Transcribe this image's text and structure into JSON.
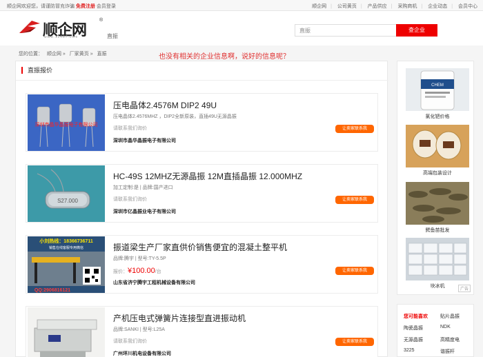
{
  "topbar": {
    "welcome": "顺企网欢迎您，请谨防冒充诈骗",
    "register": "免费注册",
    "login": "会员登录",
    "links": [
      "顺企网",
      "公司黄页",
      "产品供应",
      "采购商机",
      "企业动态",
      "会员中心"
    ]
  },
  "header": {
    "brand": "顺企网",
    "reg_mark": "®",
    "url": "www.11467.com",
    "category": "直振",
    "search_value": "直振",
    "search_button": "查企业"
  },
  "breadcrumb": {
    "prefix": "您的位置：",
    "items": [
      "顺企网",
      "厂家黄页",
      "直振"
    ],
    "sep": "»"
  },
  "overlay_note": "也没有相关的企业信息啊，说好的信息呢？",
  "section_title": "直振报价",
  "products": [
    {
      "title": "压电晶体2.4576M DIP2 49U",
      "desc": "压电晶体2.4576MHZ ，DIP2全新原装，直插49U无源晶振",
      "price_label": "请联系我们询价",
      "price_amount": "",
      "price_unit": "",
      "company": "深圳市晶华晶振电子有限公司",
      "button": "让卖家联系我"
    },
    {
      "title": "HC-49S 12MHZ无源晶振 12M直插晶振 12.000MHZ",
      "desc": "加工定制:是 | 品牌:国产进口",
      "price_label": "请联系我们询价",
      "price_amount": "",
      "price_unit": "",
      "company": "深圳市亿晶振业电子有限公司",
      "button": "让卖家联系我"
    },
    {
      "title": "振道梁生产厂家直供价销售便宜的混凝土整平机",
      "desc": "品牌:腾宇 | 型号:TY-5.5P",
      "price_label": "报价：",
      "price_amount": "¥100.00",
      "price_unit": "/台",
      "company": "山东省济宁腾宇工程机械设备有限公司",
      "button": "让卖家联系我"
    },
    {
      "title": "产机压电式弹簧片连接型直进振动机",
      "desc": "品牌:SANKI | 型号:L25A",
      "price_label": "请联系我们询价",
      "price_amount": "",
      "price_unit": "",
      "company": "广州坪川机电设备有限公司",
      "button": "让卖家联系我"
    }
  ],
  "thumb_texts": {
    "p1_banner": "深圳市晶华晶振电子有限公司",
    "p2_label": "S27.000",
    "p3_top": "小刘热线：18366736711",
    "p3_sub": "销售在线客服专用微信",
    "p3_bottom": "QQ:2906816121"
  },
  "ads": [
    {
      "caption": "氯化钯价格",
      "label_top": "CHEM"
    },
    {
      "caption": "高端包装设计"
    },
    {
      "caption": "鳄鱼苗批发"
    },
    {
      "caption": "块冰机"
    }
  ],
  "ad_tag": "广告",
  "related": {
    "head": "您可能喜欢",
    "head2": "贴片晶振",
    "items": [
      "陶瓷晶振",
      "NDK",
      "无源晶振",
      "高精度电",
      "3225",
      "谐振杆"
    ]
  }
}
